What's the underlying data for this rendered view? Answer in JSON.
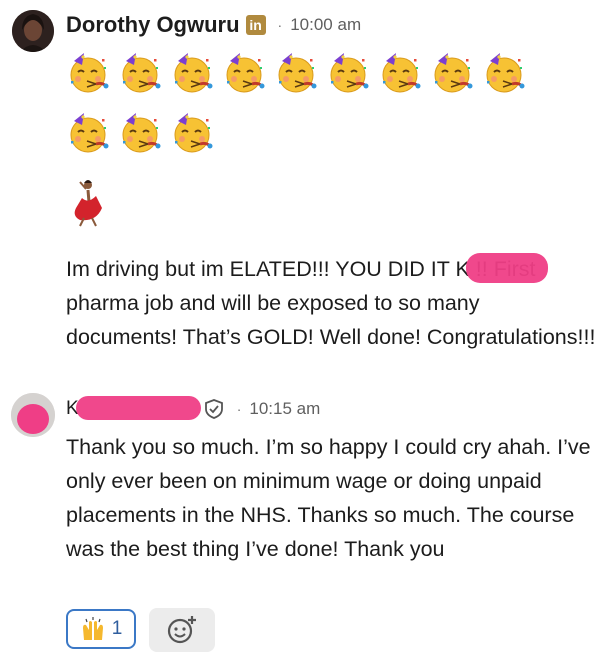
{
  "messages": [
    {
      "author": "Dorothy Ogwuru",
      "badge": "in",
      "separator": "·",
      "time": "10:00 am",
      "emoji_count_row1": 9,
      "emoji_count_row2": 3,
      "text": "Im driving but im ELATED!!! YOU DID IT K        !! First pharma job and will be exposed to so many documents! That’s GOLD! Well done! Congratulations!!!"
    },
    {
      "author": "K",
      "separator": "·",
      "time": "10:15 am",
      "text": "Thank you so much. I’m so happy I could cry ahah. I’ve only ever been on minimum wage or doing unpaid placements in the NHS. Thanks so much. The course was the best thing I’ve done! Thank you"
    }
  ],
  "reaction": {
    "icon": "raised-hands-icon",
    "count": "1"
  },
  "add_reaction": {
    "icon": "add-reaction-icon"
  },
  "colors": {
    "redaction": "#ef3e86",
    "reaction_border": "#3b78c6",
    "linkedin_badge": "#b08a3e"
  }
}
